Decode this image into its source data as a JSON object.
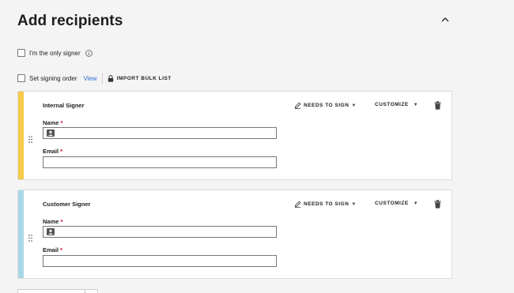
{
  "header": {
    "title": "Add recipients"
  },
  "options": {
    "only_signer_label": "I'm the only signer",
    "signing_order_label": "Set signing order",
    "view_link": "View",
    "import_bulk_label": "IMPORT BULK LIST"
  },
  "recipients": [
    {
      "role": "Internal Signer",
      "stripe_color": "#f7c948",
      "action_label": "NEEDS TO SIGN",
      "customize_label": "CUSTOMIZE",
      "name_label": "Name",
      "name_value": "",
      "email_label": "Email",
      "email_value": "",
      "required_mark": "*"
    },
    {
      "role": "Customer Signer",
      "stripe_color": "#a8d8e6",
      "action_label": "NEEDS TO SIGN",
      "customize_label": "CUSTOMIZE",
      "name_label": "Name",
      "name_value": "",
      "email_label": "Email",
      "email_value": "",
      "required_mark": "*"
    }
  ]
}
